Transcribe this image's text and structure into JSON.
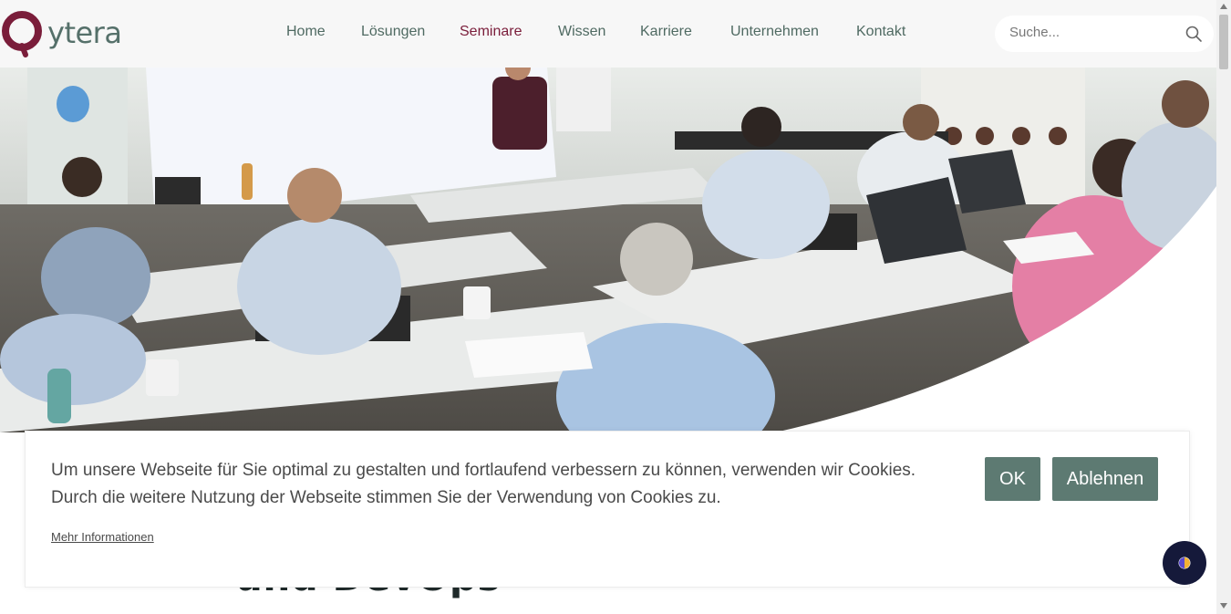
{
  "header": {
    "logo_text": "ytera",
    "nav": [
      {
        "label": "Home",
        "active": false
      },
      {
        "label": "Lösungen",
        "active": false
      },
      {
        "label": "Seminare",
        "active": true
      },
      {
        "label": "Wissen",
        "active": false
      },
      {
        "label": "Karriere",
        "active": false
      },
      {
        "label": "Unternehmen",
        "active": false
      },
      {
        "label": "Kontakt",
        "active": false
      }
    ],
    "search_placeholder": "Suche...",
    "search_icon": "search-icon"
  },
  "hero": {
    "image": "seminar-classroom-photo"
  },
  "page": {
    "heading": "und DevOps"
  },
  "cookie_banner": {
    "text_line1": "Um unsere Webseite für Sie optimal zu gestalten und fortlaufend verbessern zu können, verwenden wir Cookies.",
    "text_line2": "Durch die weitere Nutzung der Webseite stimmen Sie der Verwendung von Cookies zu.",
    "more_info": "Mehr Informationen",
    "ok_label": "OK",
    "deny_label": "Ablehnen"
  },
  "accessibility": {
    "icon": "contrast-icon"
  },
  "colors": {
    "brand_green": "#5d7a72",
    "brand_burgundy": "#7a1d3a",
    "nav_text": "#4f6a62",
    "a11y_bg": "#15193a"
  }
}
